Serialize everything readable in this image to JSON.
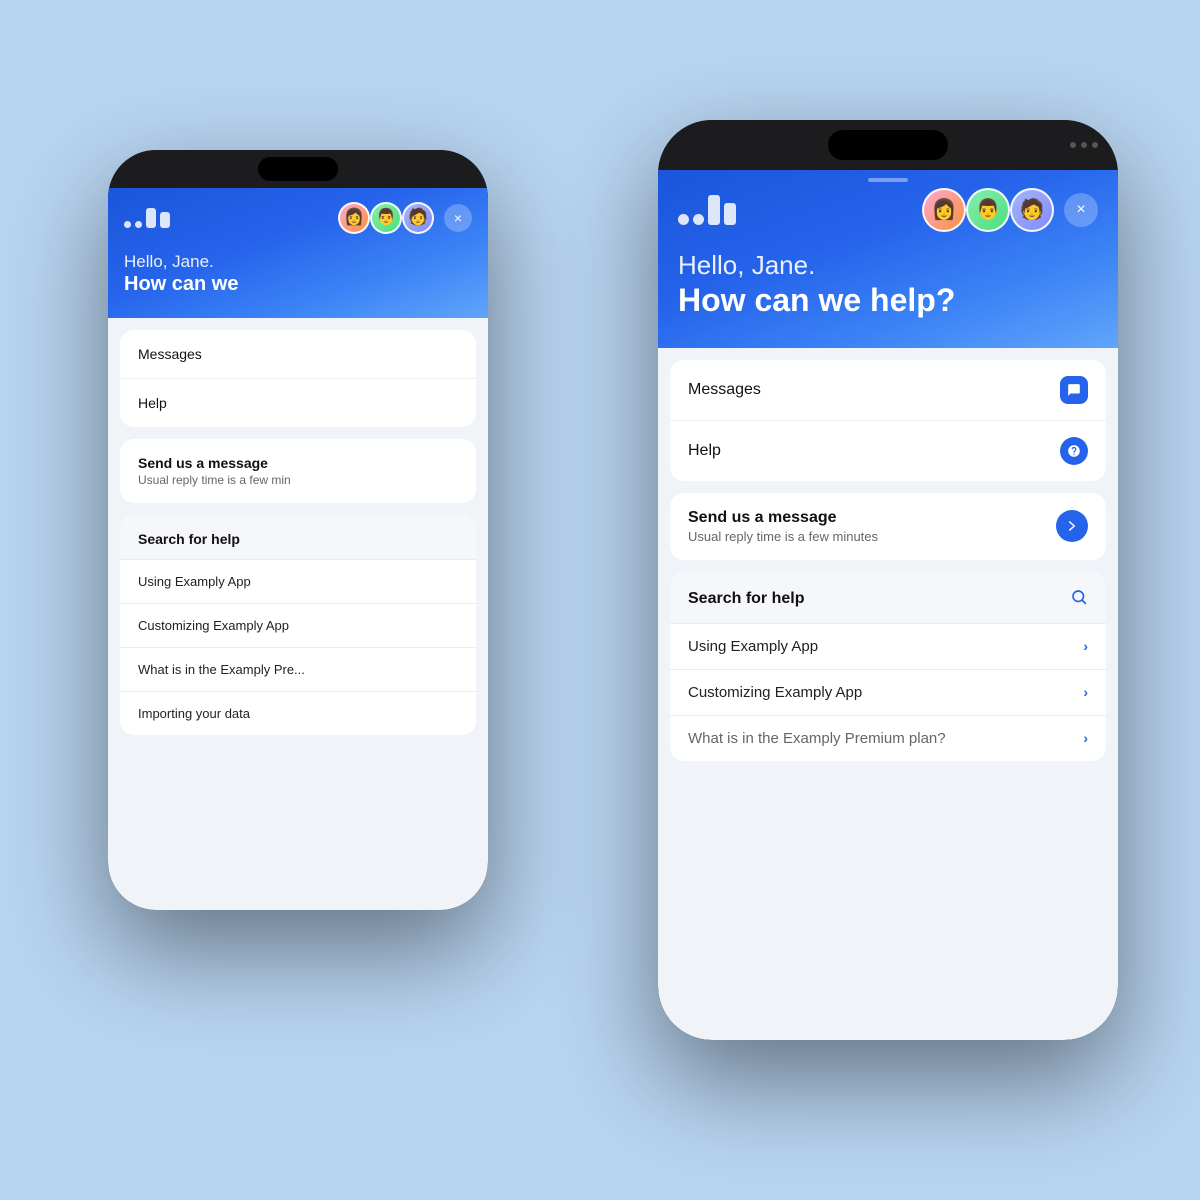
{
  "background": "#b8d4f0",
  "app": {
    "logo_label": "Intercom logo",
    "close_label": "×",
    "greeting_light": "Hello, Jane.",
    "greeting_bold": "How can we help?",
    "greeting_bold_back": "How can we",
    "nav_items": [
      {
        "label": "Messages",
        "icon": "chat"
      },
      {
        "label": "Help",
        "icon": "question"
      }
    ],
    "send_message": {
      "title": "Send us a message",
      "subtitle": "Usual reply time is a few minutes",
      "subtitle_short": "Usual reply time is a few min"
    },
    "search": {
      "header": "Search for help",
      "items": [
        "Using Examply App",
        "Customizing Examply App",
        "What is in the Examply Premium plan?",
        "Importing your data"
      ]
    }
  }
}
